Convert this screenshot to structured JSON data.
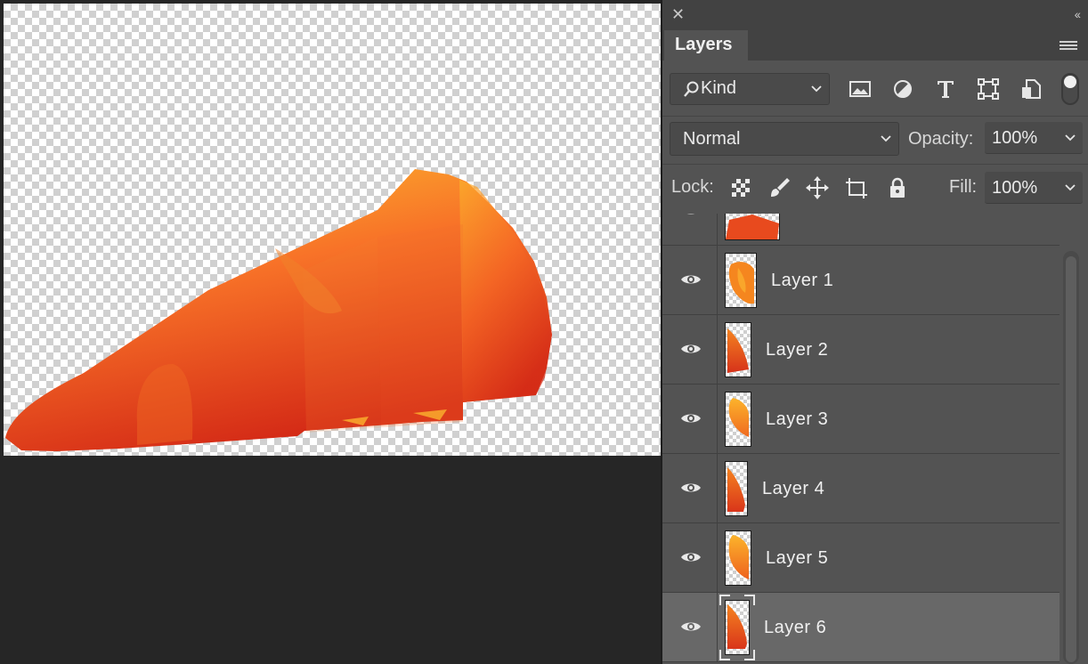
{
  "panel": {
    "title": "Layers",
    "filter": {
      "label": "Kind",
      "icons": [
        "image-filter-icon",
        "adjustment-filter-icon",
        "type-filter-icon",
        "shape-filter-icon",
        "smart-object-filter-icon"
      ]
    },
    "blend_mode": "Normal",
    "opacity_label": "Opacity:",
    "opacity_value": "100%",
    "lock_label": "Lock:",
    "fill_label": "Fill:",
    "fill_value": "100%"
  },
  "layers": [
    {
      "name": "Layer 1",
      "selected": false
    },
    {
      "name": "Layer 2",
      "selected": false
    },
    {
      "name": "Layer 3",
      "selected": false
    },
    {
      "name": "Layer 4",
      "selected": false
    },
    {
      "name": "Layer 5",
      "selected": false
    },
    {
      "name": "Layer 6",
      "selected": true
    }
  ],
  "colors": {
    "panel_bg": "#535353",
    "selected_row": "#686868",
    "shape_start": "#fcc22e",
    "shape_end": "#d42a16"
  }
}
